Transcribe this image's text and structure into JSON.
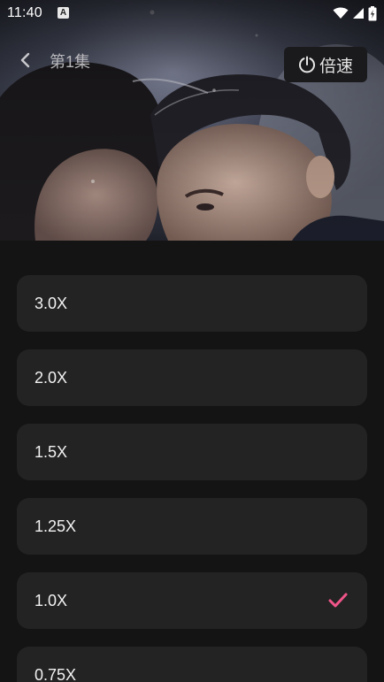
{
  "status_bar": {
    "time": "11:40",
    "notification_icon": "a-letter-icon",
    "icons": [
      "wifi-icon",
      "cellular-signal-icon",
      "battery-charging-icon"
    ]
  },
  "player": {
    "back_icon": "chevron-left-icon",
    "episode_title": "第1集",
    "speed_button": {
      "icon": "timer-icon",
      "label": "倍速"
    }
  },
  "speed_sheet": {
    "options": [
      {
        "label": "3.0X",
        "selected": false
      },
      {
        "label": "2.0X",
        "selected": false
      },
      {
        "label": "1.5X",
        "selected": false
      },
      {
        "label": "1.25X",
        "selected": false
      },
      {
        "label": "1.0X",
        "selected": true
      },
      {
        "label": "0.75X",
        "selected": false
      }
    ],
    "check_icon": "check-icon"
  },
  "colors": {
    "background": "#141414",
    "option_background": "#232323",
    "check_accent": "#f0558a",
    "speed_button_background": "#1a1a1c"
  }
}
